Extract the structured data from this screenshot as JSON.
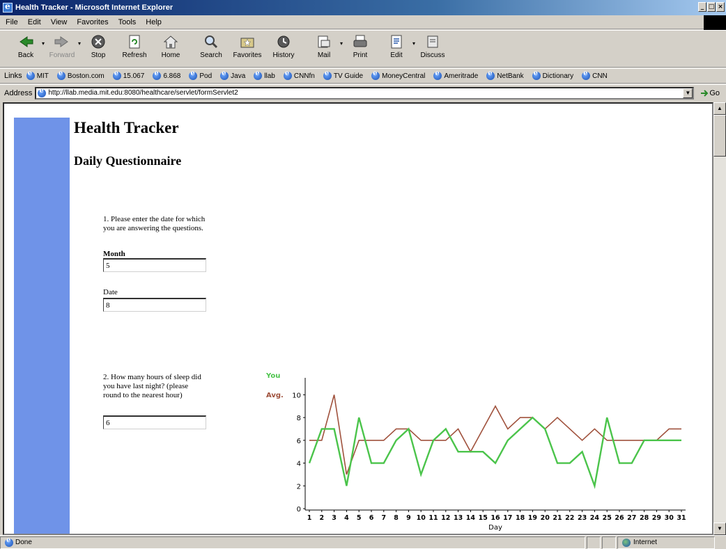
{
  "window": {
    "title": "Health Tracker - Microsoft Internet Explorer",
    "controls": [
      "_",
      "□",
      "×"
    ]
  },
  "menubar": {
    "items": [
      "File",
      "Edit",
      "View",
      "Favorites",
      "Tools",
      "Help"
    ]
  },
  "toolbar": {
    "buttons": [
      {
        "label": "Back",
        "icon": "back-arrow-icon"
      },
      {
        "label": "Forward",
        "icon": "forward-arrow-icon"
      },
      {
        "label": "Stop",
        "icon": "stop-icon"
      },
      {
        "label": "Refresh",
        "icon": "refresh-icon"
      },
      {
        "label": "Home",
        "icon": "home-icon"
      },
      {
        "label": "Search",
        "icon": "search-icon"
      },
      {
        "label": "Favorites",
        "icon": "favorites-icon"
      },
      {
        "label": "History",
        "icon": "history-icon"
      },
      {
        "label": "Mail",
        "icon": "mail-icon"
      },
      {
        "label": "Print",
        "icon": "print-icon"
      },
      {
        "label": "Edit",
        "icon": "edit-icon"
      },
      {
        "label": "Discuss",
        "icon": "discuss-icon"
      }
    ]
  },
  "links": {
    "label": "Links",
    "items": [
      "MIT",
      "Boston.com",
      "15.067",
      "6.868",
      "Pod",
      "Java",
      "llab",
      "CNNfn",
      "TV Guide",
      "MoneyCentral",
      "Ameritrade",
      "NetBank",
      "Dictionary",
      "CNN"
    ]
  },
  "address": {
    "label": "Address",
    "url": "http://llab.media.mit.edu:8080/healthcare/servlet/formServlet2",
    "go_label": "Go"
  },
  "page": {
    "title": "Health Tracker",
    "section": "Daily Questionnaire",
    "q1": {
      "text": "1. Please enter the date for which you are answering the questions.",
      "month_label": "Month",
      "month_value": "5",
      "date_label": "Date",
      "date_value": "8"
    },
    "q2": {
      "text": "2. How many hours of sleep did you have last night? (please round to the nearest hour)",
      "value": "6"
    }
  },
  "chart_data": {
    "type": "line",
    "xlabel": "Day",
    "ylabel": "",
    "ylim": [
      0,
      11
    ],
    "yticks": [
      0,
      2,
      4,
      6,
      8,
      10
    ],
    "x": [
      1,
      2,
      3,
      4,
      5,
      6,
      7,
      8,
      9,
      10,
      11,
      12,
      13,
      14,
      15,
      16,
      17,
      18,
      19,
      20,
      21,
      22,
      23,
      24,
      25,
      26,
      27,
      28,
      29,
      30,
      31
    ],
    "series": [
      {
        "name": "You",
        "color": "#4bc44b",
        "values": [
          4,
          7,
          7,
          2,
          8,
          4,
          4,
          6,
          7,
          3,
          6,
          7,
          5,
          5,
          5,
          4,
          6,
          7,
          8,
          7,
          4,
          4,
          5,
          2,
          8,
          4,
          4,
          6,
          6,
          6,
          6
        ]
      },
      {
        "name": "Avg.",
        "color": "#a0523d",
        "values": [
          6,
          6,
          10,
          3,
          6,
          6,
          6,
          7,
          7,
          6,
          6,
          6,
          7,
          5,
          7,
          9,
          7,
          8,
          8,
          7,
          8,
          7,
          6,
          7,
          6,
          6,
          6,
          6,
          6,
          7,
          7
        ]
      }
    ],
    "legend_position": "top-left"
  },
  "status": {
    "left": "Done",
    "zone": "Internet"
  }
}
